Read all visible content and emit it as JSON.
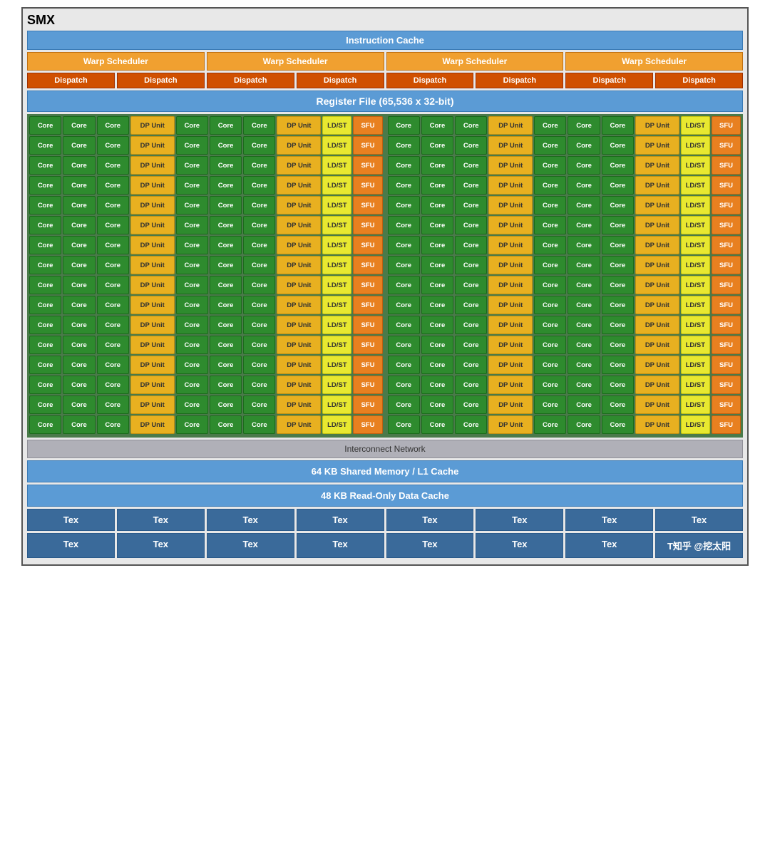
{
  "title": "SMX",
  "instruction_cache": "Instruction Cache",
  "warp_schedulers": [
    "Warp Scheduler",
    "Warp Scheduler",
    "Warp Scheduler",
    "Warp Scheduler"
  ],
  "dispatch_units": [
    "Dispatch",
    "Dispatch",
    "Dispatch",
    "Dispatch",
    "Dispatch",
    "Dispatch",
    "Dispatch",
    "Dispatch"
  ],
  "register_file": "Register File (65,536 x 32-bit)",
  "interconnect": "Interconnect Network",
  "shared_memory": "64 KB Shared Memory / L1 Cache",
  "readonly_cache": "48 KB Read-Only Data Cache",
  "tex_rows": [
    [
      "Tex",
      "Tex",
      "Tex",
      "Tex",
      "Tex",
      "Tex",
      "Tex",
      "Tex"
    ],
    [
      "Tex",
      "Tex",
      "Tex",
      "Tex",
      "Tex",
      "Tex",
      "Tex",
      "T知乎 @挖太阳"
    ]
  ],
  "core_label": "Core",
  "dp_label": "DP Unit",
  "ldst_label": "LD/ST",
  "sfu_label": "SFU",
  "num_core_rows": 16,
  "colors": {
    "core": "#2e8b2e",
    "dp": "#e8b020",
    "ldst": "#e8e830",
    "sfu": "#e88020",
    "warp": "#f0a030",
    "dispatch": "#d05000",
    "cache": "#5b9bd5",
    "tex": "#3a6a9a"
  }
}
